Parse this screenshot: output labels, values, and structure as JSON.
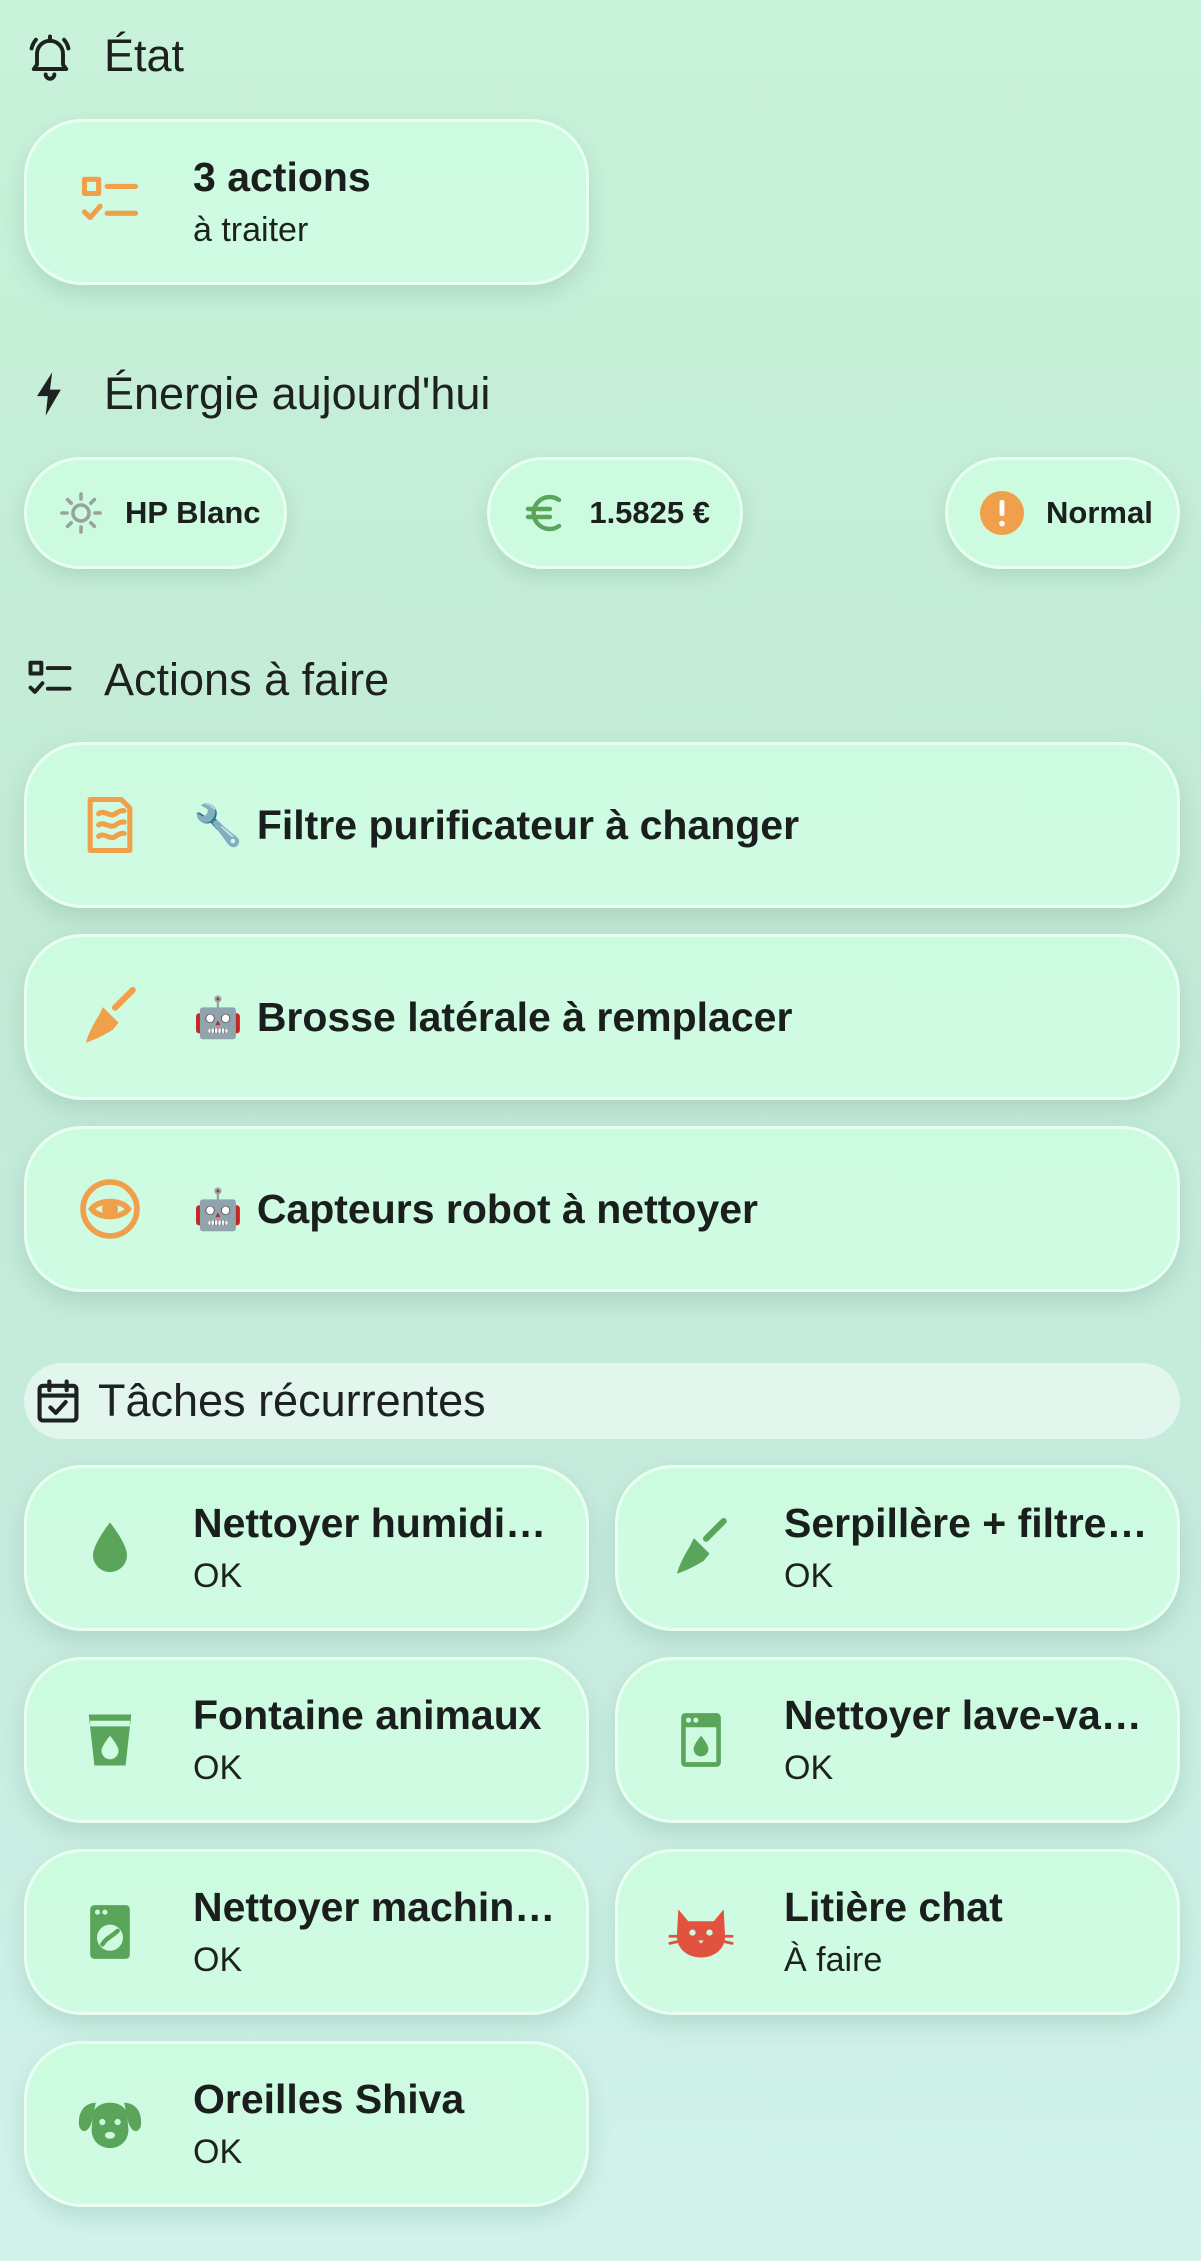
{
  "sections": {
    "etat": "État",
    "energie": "Énergie aujourd'hui",
    "actions": "Actions à faire",
    "taches": "Tâches récurrentes"
  },
  "status_card": {
    "primary": "3 actions",
    "secondary": "à traiter"
  },
  "energy_chips": [
    {
      "label": "HP Blanc",
      "icon": "sun-icon"
    },
    {
      "label": "1.5825 €",
      "icon": "euro-icon"
    },
    {
      "label": "Normal",
      "icon": "alert-circle-icon"
    }
  ],
  "actions": [
    {
      "emoji": "🔧",
      "label": "Filtre purificateur à changer",
      "icon": "air-filter-icon"
    },
    {
      "emoji": "🤖",
      "label": "Brosse latérale à remplacer",
      "icon": "broom-icon"
    },
    {
      "emoji": "🤖",
      "label": "Capteurs robot à nettoyer",
      "icon": "eye-icon"
    }
  ],
  "tasks": [
    {
      "name": "Nettoyer humidificateur",
      "status": "OK",
      "icon": "water-drop-icon"
    },
    {
      "name": "Serpillère + filtre robot",
      "status": "OK",
      "icon": "broom-icon"
    },
    {
      "name": "Fontaine animaux",
      "status": "OK",
      "icon": "cup-water-icon"
    },
    {
      "name": "Nettoyer lave-vaisselle",
      "status": "OK",
      "icon": "dishwasher-icon"
    },
    {
      "name": "Nettoyer machine à laver",
      "status": "OK",
      "icon": "washing-machine-icon"
    },
    {
      "name": "Litière chat",
      "status": "À faire",
      "icon": "cat-icon"
    },
    {
      "name": "Oreilles Shiva",
      "status": "OK",
      "icon": "dog-icon"
    }
  ],
  "colors": {
    "orange": "#f0a04b",
    "green": "#5aa55a",
    "red": "#e2533f",
    "grey_icon": "#9aa29d",
    "text": "#1d211f"
  }
}
